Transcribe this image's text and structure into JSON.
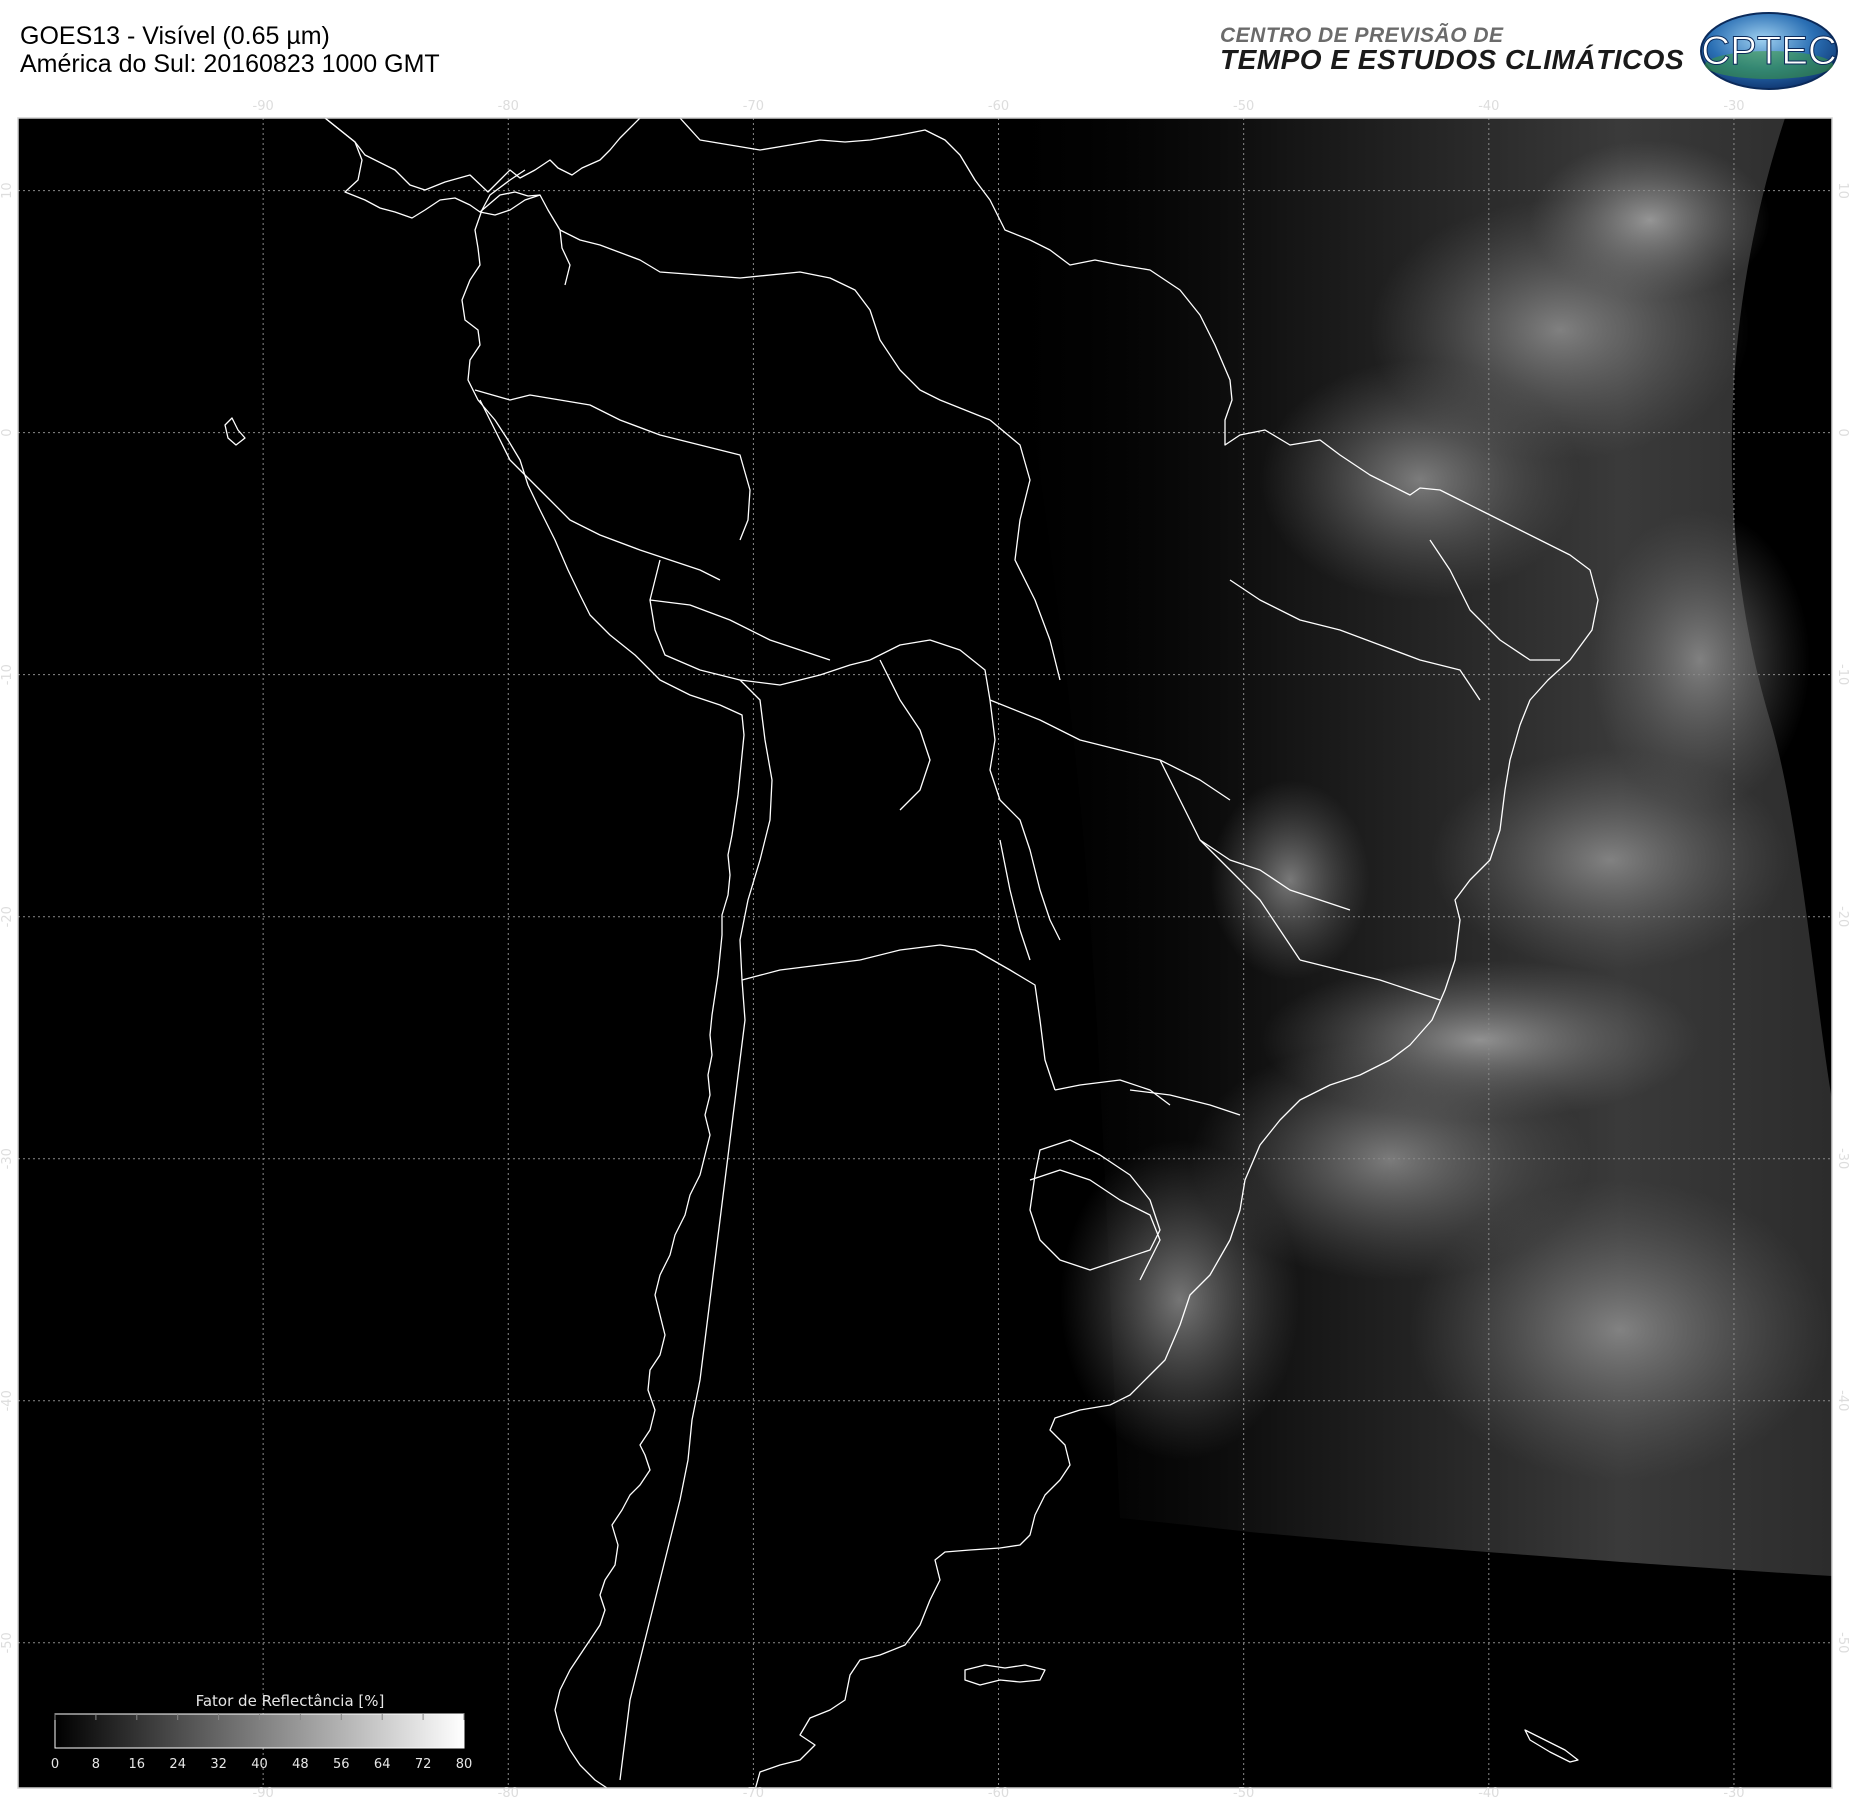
{
  "header": {
    "title_line1": "GOES13 - Visível (0.65 µm)",
    "title_line2": "América do Sul: 20160823 1000 GMT",
    "org_line1": "CENTRO DE PREVISÃO DE",
    "org_line2": "TEMPO E ESTUDOS CLIMÁTICOS",
    "logo_text": "CPTEC"
  },
  "map": {
    "longitude_ticks": [
      "-90",
      "-80",
      "-70",
      "-60",
      "-50",
      "-40",
      "-30"
    ],
    "latitude_ticks": [
      "10",
      "0",
      "-10",
      "-20",
      "-30",
      "-40",
      "-50"
    ],
    "lon_range": [
      -100,
      -26
    ],
    "lat_range": [
      13,
      -56
    ],
    "colors": {
      "background": "#000000",
      "coastline": "#ffffff",
      "grid": "#8a8a8a"
    }
  },
  "colorbar": {
    "title": "Fator de Reflectância [%]",
    "labels": [
      "0",
      "8",
      "16",
      "24",
      "32",
      "40",
      "48",
      "56",
      "64",
      "72",
      "80"
    ]
  }
}
